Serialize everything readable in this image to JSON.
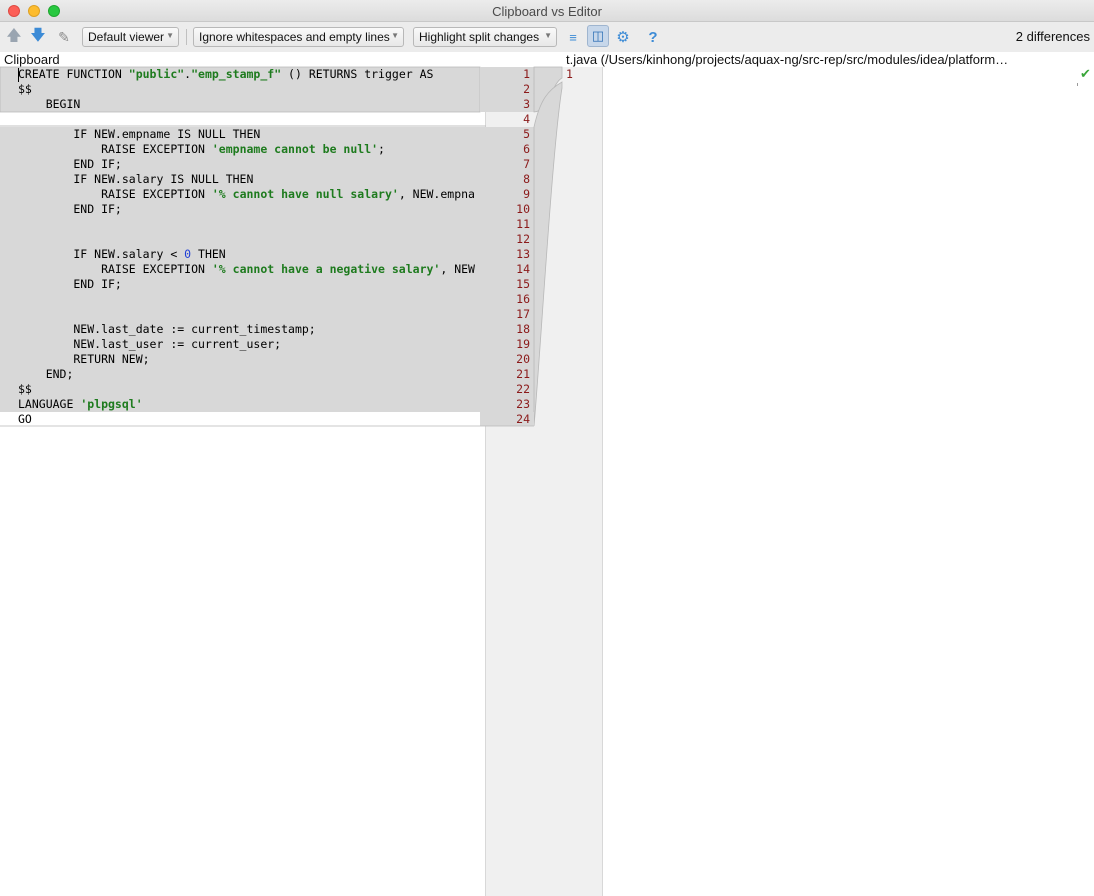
{
  "window": {
    "title": "Clipboard vs Editor"
  },
  "toolbar": {
    "prev_icon": "arrow-up-icon",
    "next_icon": "arrow-down-icon",
    "edit_icon": "edit-source-icon",
    "viewer": "Default viewer",
    "ignore": "Ignore whitespaces and empty lines",
    "highlight": "Highlight split changes",
    "differences": "2 differences"
  },
  "left_panel": {
    "header": "Clipboard"
  },
  "right_panel": {
    "header": "t.java (/Users/kinhong/projects/aquax-ng/src-rep/src/modules/idea/platform…",
    "line_numbers": [
      "1"
    ]
  },
  "code": {
    "lines": [
      "CREATE FUNCTION \"public\".\"emp_stamp_f\" () RETURNS trigger AS",
      "$$",
      "    BEGIN",
      "",
      "        IF NEW.empname IS NULL THEN",
      "            RAISE EXCEPTION 'empname cannot be null';",
      "        END IF;",
      "        IF NEW.salary IS NULL THEN",
      "            RAISE EXCEPTION '% cannot have null salary', NEW.empna",
      "        END IF;",
      "",
      "",
      "        IF NEW.salary < 0 THEN",
      "            RAISE EXCEPTION '% cannot have a negative salary', NEW",
      "        END IF;",
      "",
      "",
      "        NEW.last_date := current_timestamp;",
      "        NEW.last_user := current_user;",
      "        RETURN NEW;",
      "    END;",
      "$$",
      "LANGUAGE 'plpgsql'",
      "GO"
    ],
    "line_numbers": [
      "1",
      "2",
      "3",
      "4",
      "5",
      "6",
      "7",
      "8",
      "9",
      "10",
      "11",
      "12",
      "13",
      "14",
      "15",
      "16",
      "17",
      "18",
      "19",
      "20",
      "21",
      "22",
      "23",
      "24"
    ]
  },
  "colors": {
    "changed_block": "#d8d8d8",
    "string": "#1e7b1e",
    "number": "#1f3fd6",
    "line_number": "#8b1a1a"
  }
}
